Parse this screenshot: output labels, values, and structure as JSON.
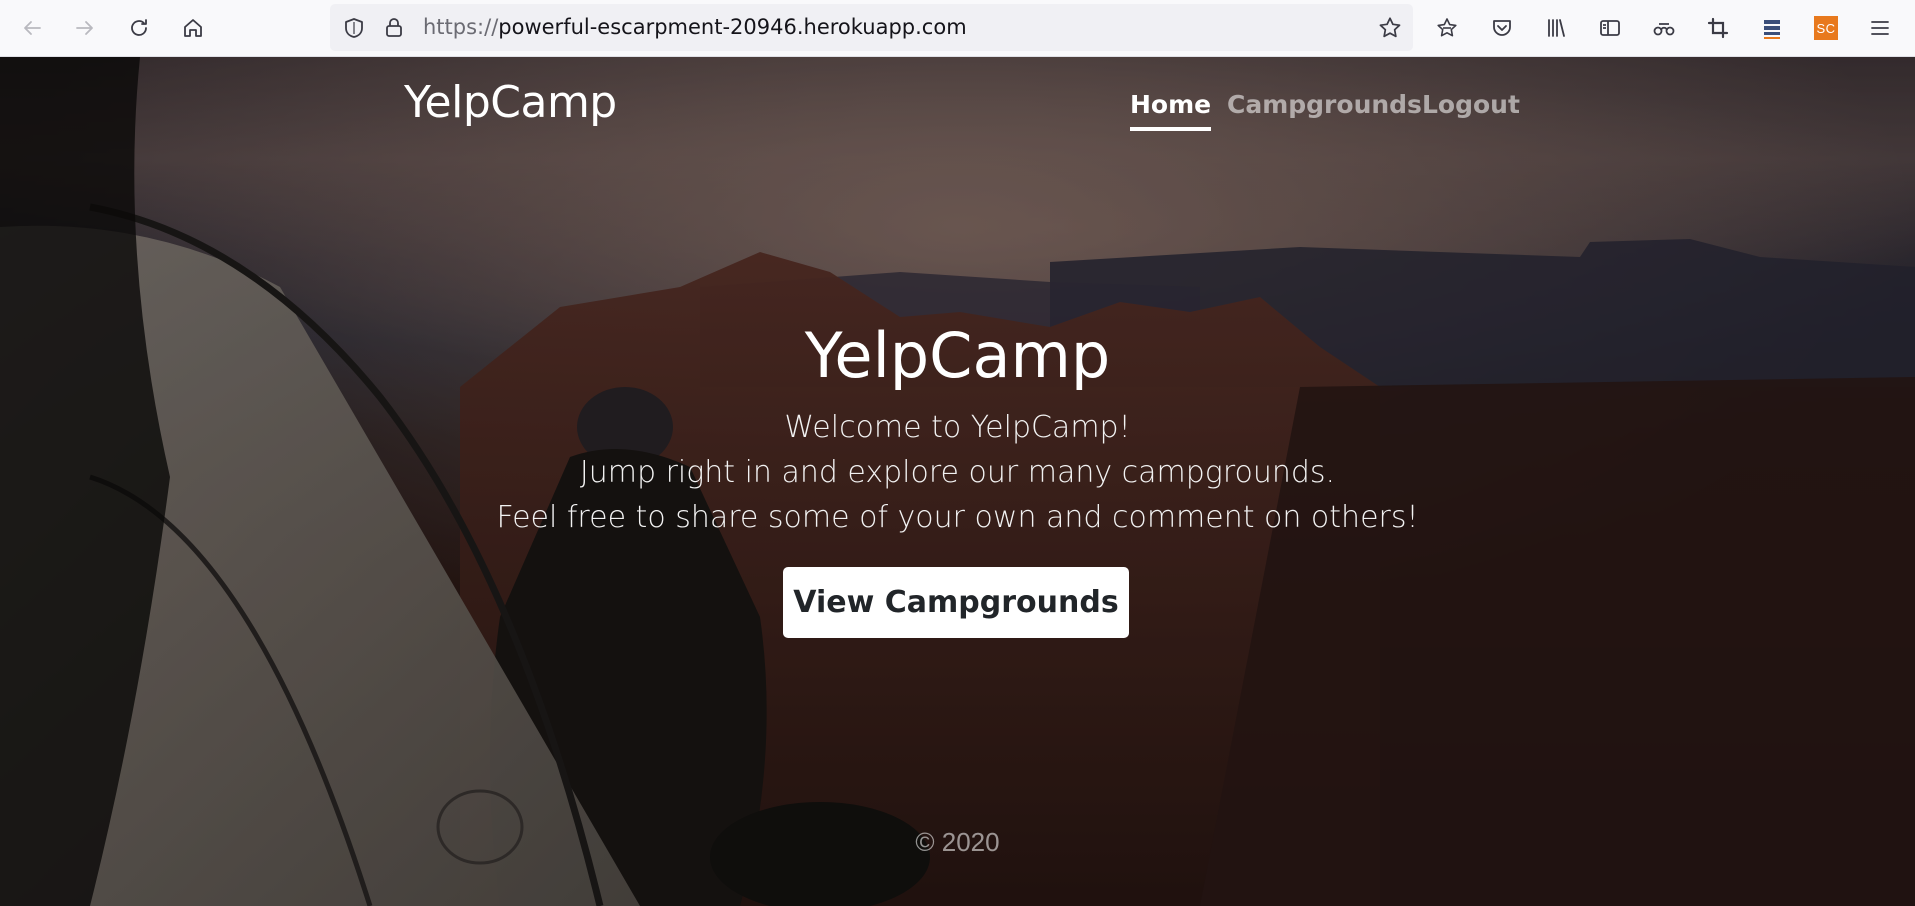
{
  "browser": {
    "url_scheme": "https://",
    "url_host": "powerful-escarpment-20946.herokuapp.com",
    "extension_badge": "SC",
    "toolbar_icons": [
      "back-icon",
      "forward-icon",
      "reload-icon",
      "home-icon",
      "shield-icon",
      "lock-icon",
      "bookmark-star-icon",
      "reading-list-icon",
      "pocket-icon",
      "library-icon",
      "sidebar-icon",
      "extension-icon",
      "crop-icon",
      "stack-icon",
      "menu-icon"
    ]
  },
  "navbar": {
    "brand": "YelpCamp",
    "links": [
      {
        "label": "Home",
        "active": true
      },
      {
        "label": "Campgrounds",
        "active": false
      },
      {
        "label": "Logout",
        "active": false
      }
    ]
  },
  "hero": {
    "title": "YelpCamp",
    "lines": [
      "Welcome to YelpCamp!",
      "Jump right in and explore our many campgrounds.",
      "Feel free to share some of your own and comment on others!"
    ],
    "button_label": "View Campgrounds"
  },
  "footer": {
    "copyright": "© 2020"
  },
  "colors": {
    "text_primary": "#ffffff",
    "nav_inactive": "rgba(255,255,255,0.55)",
    "button_bg": "#ffffff",
    "button_text": "#212529",
    "badge_orange": "#e8791d"
  }
}
